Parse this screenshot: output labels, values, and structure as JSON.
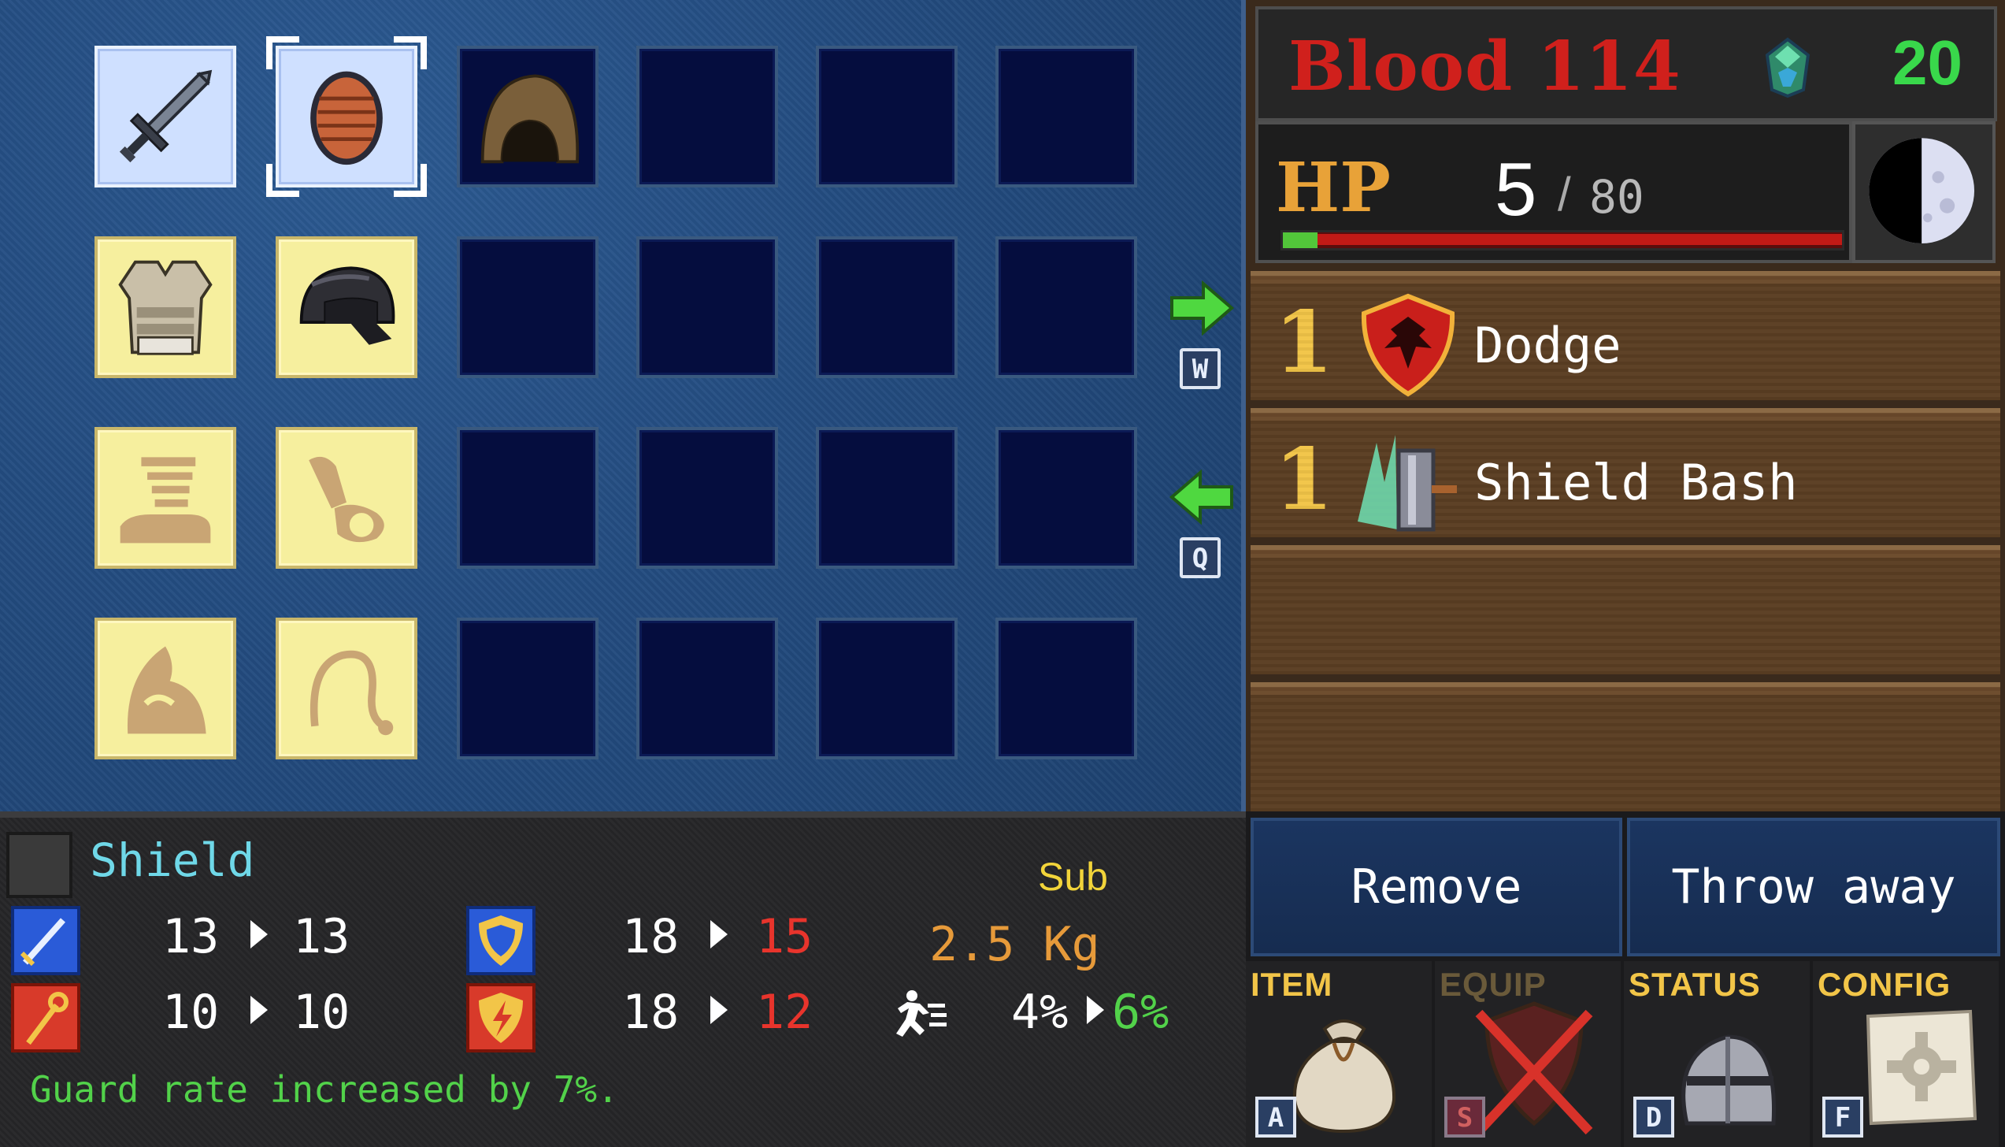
{
  "resources": {
    "blood_label": "Blood",
    "blood_value": "114",
    "gem_count": "20"
  },
  "hp": {
    "label": "HP",
    "current": "5",
    "separator": "/",
    "max": "80",
    "fraction": 0.0625
  },
  "inventory": {
    "slots_cols": 6,
    "slots_rows": 4,
    "equipped": [
      "sword-icon",
      "shield-icon",
      "hood-icon",
      "armor-icon",
      "helmet-icon",
      "gauntlet-placeholder-icon",
      "bracer-placeholder-icon",
      "cloak-placeholder-icon",
      "ring-placeholder-icon"
    ],
    "swap_right_key": "W",
    "swap_left_key": "Q"
  },
  "skills": [
    {
      "level": "1",
      "name": "Dodge",
      "icon": "dodge-shield-icon"
    },
    {
      "level": "1",
      "name": "Shield Bash",
      "icon": "shield-bash-icon"
    }
  ],
  "selected_item": {
    "name": "Shield",
    "slot": "Sub",
    "attack": {
      "from": "13",
      "to": "13"
    },
    "magic": {
      "from": "10",
      "to": "10"
    },
    "defense": {
      "from": "18",
      "to": "15"
    },
    "magic_defense": {
      "from": "18",
      "to": "12"
    },
    "weight": "2.5 Kg",
    "evasion": {
      "from": "4%",
      "to": "6%"
    },
    "description": "Guard rate increased by 7%."
  },
  "actions": {
    "remove": "Remove",
    "throw_away": "Throw away"
  },
  "menu": [
    {
      "label": "ITEM",
      "key": "A",
      "icon": "bag-icon"
    },
    {
      "label": "EQUIP",
      "key": "S",
      "icon": "equip-disabled-icon"
    },
    {
      "label": "STATUS",
      "key": "D",
      "icon": "knight-helmet-icon"
    },
    {
      "label": "CONFIG",
      "key": "F",
      "icon": "gear-scroll-icon"
    }
  ],
  "colors": {
    "blood": "#d0201c",
    "gems": "#39d84b",
    "hp_label": "#e8a238",
    "stat_down": "#e8342c",
    "stat_up": "#52d24a",
    "item_name": "#6fd8e8"
  }
}
